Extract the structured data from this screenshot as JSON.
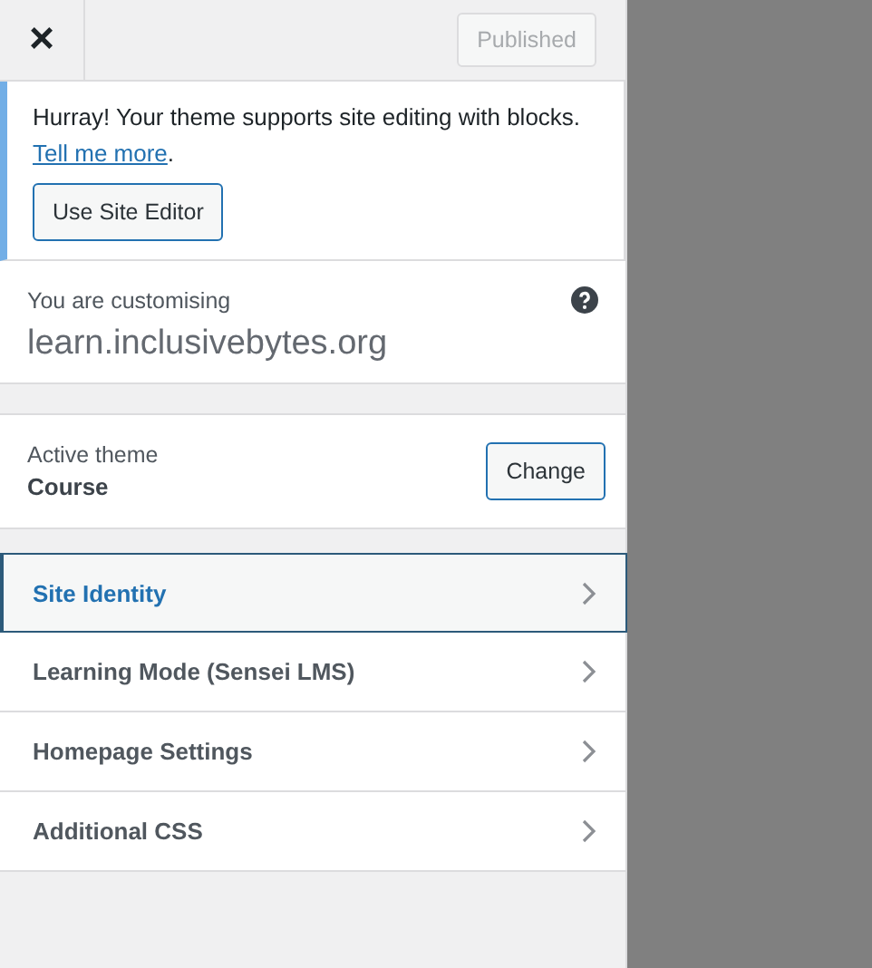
{
  "header": {
    "close": "×",
    "publish_button": {
      "label": "Published",
      "disabled": true
    }
  },
  "notice": {
    "text": "Hurray! Your theme supports site editing with blocks.",
    "link": "Tell me more",
    "after_link": ".",
    "button": "Use Site Editor"
  },
  "customising": {
    "label": "You are customising",
    "site": "learn.inclusivebytes.org"
  },
  "theme": {
    "label": "Active theme",
    "name": "Course",
    "button": "Change"
  },
  "sections": [
    {
      "label": "Site Identity",
      "selected": true
    },
    {
      "label": "Learning Mode (Sensei LMS)",
      "selected": false
    },
    {
      "label": "Homepage Settings",
      "selected": false
    },
    {
      "label": "Additional CSS",
      "selected": false
    }
  ]
}
